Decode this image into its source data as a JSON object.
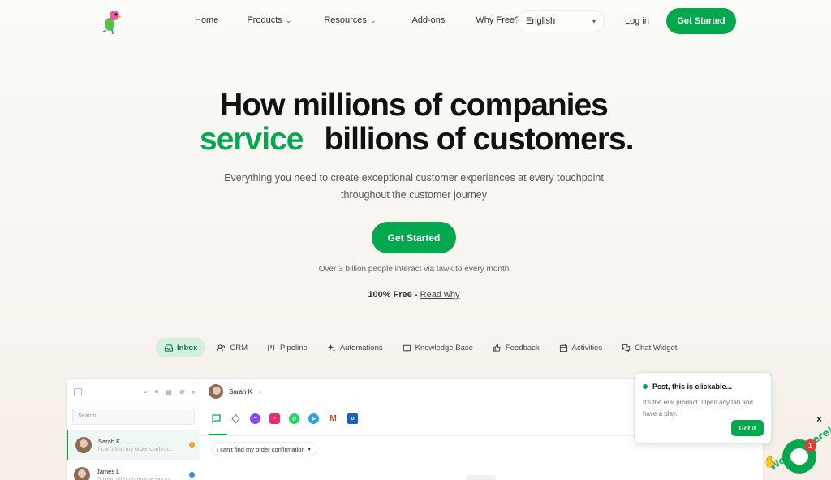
{
  "nav": {
    "items": [
      {
        "label": "Home",
        "has_menu": false
      },
      {
        "label": "Products",
        "has_menu": true
      },
      {
        "label": "Resources",
        "has_menu": true
      },
      {
        "label": "Add-ons",
        "has_menu": false
      },
      {
        "label": "Why Free?",
        "has_menu": false
      }
    ],
    "language": "English",
    "login": "Log in",
    "cta": "Get Started"
  },
  "hero": {
    "line1": "How millions of companies",
    "line2_highlight": "service",
    "line2_rest": "billions of customers.",
    "subtitle": "Everything you need to create exceptional customer experiences at every touchpoint throughout the customer journey",
    "cta": "Get Started",
    "stat": "Over 3 billion people interact via tawk.to every month",
    "free_label": "100% Free - ",
    "free_link": "Read why"
  },
  "tabs": [
    {
      "label": "Inbox",
      "icon": "inbox-icon",
      "active": true
    },
    {
      "label": "CRM",
      "icon": "users-icon",
      "active": false
    },
    {
      "label": "Pipeline",
      "icon": "pipeline-icon",
      "active": false
    },
    {
      "label": "Automations",
      "icon": "sparkle-icon",
      "active": false
    },
    {
      "label": "Knowledge Base",
      "icon": "book-icon",
      "active": false
    },
    {
      "label": "Feedback",
      "icon": "thumbs-up-icon",
      "active": false
    },
    {
      "label": "Activities",
      "icon": "calendar-icon",
      "active": false
    },
    {
      "label": "Chat Widget",
      "icon": "chat-icon",
      "active": false
    }
  ],
  "app": {
    "search_placeholder": "Search...",
    "conversations": [
      {
        "name": "Sarah K",
        "message": "I can't find my order confirm...",
        "dot_color": "#f0a32a"
      },
      {
        "name": "James L",
        "message": "Do you offer enterprise pricin...",
        "dot_color": "#2e8ee8"
      }
    ],
    "active_contact": "Sarah K",
    "subject": "I can't find my order confirmation",
    "channels": [
      "chat-icon",
      "webhook-icon",
      "messenger-icon",
      "instagram-icon",
      "whatsapp-icon",
      "telegram-icon",
      "gmail-icon",
      "outlook-icon"
    ]
  },
  "popup": {
    "title": "Psst, this is clickable...",
    "text": "It's the real product. Open any tab and have a play.",
    "button": "Got it"
  },
  "chat_widget": {
    "label": "We Are Here!",
    "badge": "1",
    "close": "×"
  },
  "colors": {
    "brand_green": "#03a84e",
    "active_tab_bg": "#d5efdf"
  }
}
